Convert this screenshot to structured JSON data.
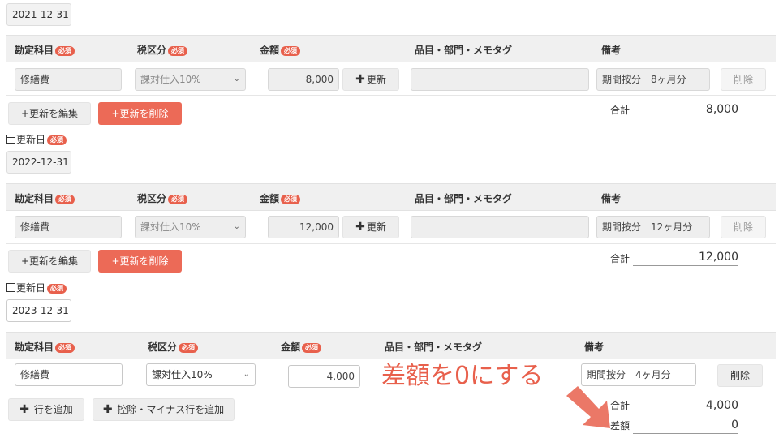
{
  "blocks": [
    {
      "date": "2021-12-31",
      "headers": {
        "account": "勘定科目",
        "tax": "税区分",
        "amount": "金額",
        "item": "品目・部門・メモタグ",
        "note": "備考",
        "required": "必須"
      },
      "row": {
        "account": "修繕費",
        "tax": "課対仕入10%",
        "amount": "8,000",
        "update": "更新",
        "note": "期間按分　8ヶ月分",
        "delete": "削除"
      },
      "buttons": {
        "edit": "+更新を編集",
        "remove": "+更新を削除"
      },
      "total_label": "合計",
      "total": "8,000"
    },
    {
      "updated_label": "更新日",
      "date": "2022-12-31",
      "headers": {
        "account": "勘定科目",
        "tax": "税区分",
        "amount": "金額",
        "item": "品目・部門・メモタグ",
        "note": "備考",
        "required": "必須"
      },
      "row": {
        "account": "修繕費",
        "tax": "課対仕入10%",
        "amount": "12,000",
        "update": "更新",
        "note": "期間按分　12ヶ月分",
        "delete": "削除"
      },
      "buttons": {
        "edit": "+更新を編集",
        "remove": "+更新を削除"
      },
      "total_label": "合計",
      "total": "12,000"
    },
    {
      "updated_label": "更新日",
      "date": "2023-12-31",
      "headers": {
        "account": "勘定科目",
        "tax": "税区分",
        "amount": "金額",
        "item": "品目・部門・メモタグ",
        "note": "備考",
        "required": "必須"
      },
      "row": {
        "account": "修繕費",
        "tax": "課対仕入10%",
        "amount": "4,000",
        "note": "期間按分　4ヶ月分",
        "delete": "削除"
      },
      "buttons": {
        "add_row": "行を追加",
        "add_deduct": "控除・マイナス行を追加"
      },
      "total_label": "合計",
      "total": "4,000",
      "diff_label": "差額",
      "diff": "0"
    }
  ],
  "annotation": {
    "text": "差額を0にする",
    "color": "#e8604c"
  },
  "colors": {
    "accent": "#ec6a57",
    "header_bg": "#f0f0f0"
  },
  "icons": {
    "calendar": "calendar-icon",
    "plus": "plus-icon",
    "chevron": "chevron-down-icon",
    "arrow": "arrow-icon"
  }
}
